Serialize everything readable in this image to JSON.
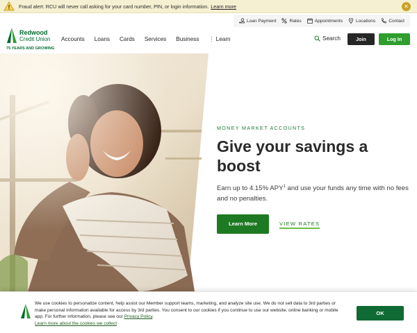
{
  "alert": {
    "text": "Fraud alert: RCU will never call asking for your card number, PIN, or login information.",
    "link": "Learn more",
    "close_icon": "close-icon"
  },
  "utility_nav": [
    {
      "label": "Loan Payment",
      "icon": "hand-coin-icon"
    },
    {
      "label": "Rates",
      "icon": "percent-icon"
    },
    {
      "label": "Appointments",
      "icon": "calendar-icon"
    },
    {
      "label": "Locations",
      "icon": "location-pin-icon"
    },
    {
      "label": "Contact",
      "icon": "phone-icon"
    }
  ],
  "logo": {
    "line1": "Redwood",
    "line2": "Credit Union",
    "tagline": "75 YEARS AND GROWING"
  },
  "nav": {
    "items": [
      "Accounts",
      "Loans",
      "Cards",
      "Services",
      "Business"
    ],
    "learn": "Learn",
    "search": "Search",
    "join": "Join",
    "login": "Log In"
  },
  "hero": {
    "eyebrow": "MONEY MARKET ACCOUNTS",
    "headline": "Give your savings a boost",
    "sub_before": "Earn up to 4.15% APY",
    "sub_sup": "1",
    "sub_after": " and use your funds any time with no fees and no penalties.",
    "cta_primary": "Learn More",
    "cta_secondary": "VIEW RATES"
  },
  "cookie": {
    "text_1": "We use cookies to personalize content, help assist our Member support teams, marketing, and analyze site use. We do not sell data to 3rd parties or make personal information available for access by 3rd parties. You consent to our cookies if you continue to use our website, online banking or mobile app. For further information, please see our ",
    "privacy_link": "Privacy Policy",
    "text_2": ".",
    "learn_link": "Learn more about the cookies we collect",
    "ok": "OK"
  },
  "colors": {
    "brand_green": "#006b2e",
    "cta_green": "#1e7a22",
    "login_green": "#2f9e2f",
    "alert_bg": "#f6f0d2"
  }
}
